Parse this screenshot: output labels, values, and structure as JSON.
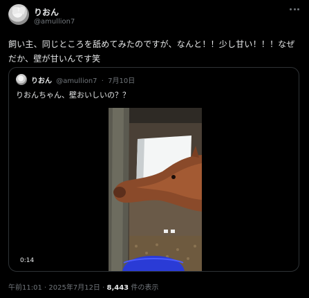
{
  "author": {
    "name": "りおん",
    "handle": "@amullion7"
  },
  "tweet": {
    "text": "飼い主、同じところを舐めてみたのですが、なんと！！少し甘い！！！なぜだか、壁が甘いんです笑"
  },
  "quote": {
    "name": "りおん",
    "handle": "@amullion7",
    "date": "7月10日",
    "text": "りおんちゃん、壁おいしいの？？",
    "video_duration": "0:14"
  },
  "meta": {
    "time": "午前11:01",
    "date": "2025年7月12日",
    "views": "8,443",
    "views_label": "件の表示",
    "separator": "·"
  },
  "icons": {
    "more": "more-horizontal-icon"
  }
}
